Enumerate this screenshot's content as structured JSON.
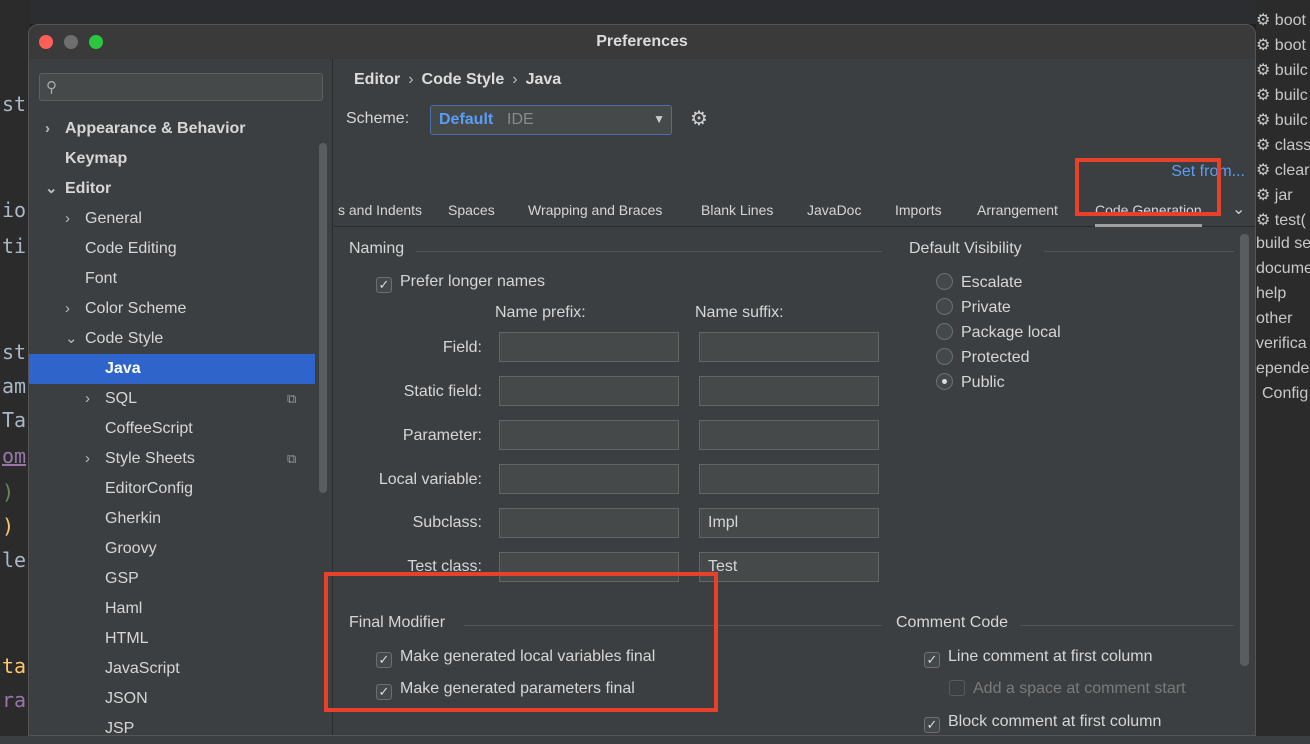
{
  "window": {
    "title": "Preferences"
  },
  "search": {
    "placeholder": ""
  },
  "sidebar": {
    "items": [
      {
        "label": "Appearance & Behavior"
      },
      {
        "label": "Keymap"
      },
      {
        "label": "Editor"
      },
      {
        "label": "General"
      },
      {
        "label": "Code Editing"
      },
      {
        "label": "Font"
      },
      {
        "label": "Color Scheme"
      },
      {
        "label": "Code Style"
      },
      {
        "label": "Java"
      },
      {
        "label": "SQL"
      },
      {
        "label": "CoffeeScript"
      },
      {
        "label": "Style Sheets"
      },
      {
        "label": "EditorConfig"
      },
      {
        "label": "Gherkin"
      },
      {
        "label": "Groovy"
      },
      {
        "label": "GSP"
      },
      {
        "label": "Haml"
      },
      {
        "label": "HTML"
      },
      {
        "label": "JavaScript"
      },
      {
        "label": "JSON"
      },
      {
        "label": "JSP"
      }
    ]
  },
  "breadcrumb": {
    "a": "Editor",
    "b": "Code Style",
    "c": "Java",
    "sep": "›"
  },
  "scheme": {
    "label": "Scheme:",
    "value": "Default",
    "sub": "IDE"
  },
  "set_from": "Set from...",
  "tabs": [
    {
      "label": "s and Indents"
    },
    {
      "label": "Spaces"
    },
    {
      "label": "Wrapping and Braces"
    },
    {
      "label": "Blank Lines"
    },
    {
      "label": "JavaDoc"
    },
    {
      "label": "Imports"
    },
    {
      "label": "Arrangement"
    },
    {
      "label": "Code Generation"
    }
  ],
  "naming": {
    "title": "Naming",
    "prefer_longer": "Prefer longer names",
    "prefix_head": "Name prefix:",
    "suffix_head": "Name suffix:",
    "rows": [
      {
        "label": "Field:",
        "prefix": "",
        "suffix": ""
      },
      {
        "label": "Static field:",
        "prefix": "",
        "suffix": ""
      },
      {
        "label": "Parameter:",
        "prefix": "",
        "suffix": ""
      },
      {
        "label": "Local variable:",
        "prefix": "",
        "suffix": ""
      },
      {
        "label": "Subclass:",
        "prefix": "",
        "suffix": "Impl"
      },
      {
        "label": "Test class:",
        "prefix": "",
        "suffix": "Test"
      }
    ]
  },
  "visibility": {
    "title": "Default Visibility",
    "options": [
      {
        "label": "Escalate"
      },
      {
        "label": "Private"
      },
      {
        "label": "Package local"
      },
      {
        "label": "Protected"
      },
      {
        "label": "Public"
      }
    ],
    "selected": "Public"
  },
  "final_modifier": {
    "title": "Final Modifier",
    "local_vars": "Make generated local variables final",
    "params": "Make generated parameters final"
  },
  "comment_code": {
    "title": "Comment Code",
    "line_first": "Line comment at first column",
    "add_space": "Add a space at comment start",
    "block_first": "Block comment at first column"
  },
  "background": {
    "right_items": [
      "boot",
      "boot",
      "builc",
      "builc",
      "builc",
      "class",
      "clear",
      "jar",
      "test(",
      "build se",
      "docume",
      "help",
      "other",
      "verifica",
      "epender",
      "Config"
    ],
    "left_frags": [
      "st",
      "io",
      "ti",
      "st",
      "am",
      "Ta",
      "om",
      ")",
      ")",
      "le",
      "ta",
      "ra"
    ]
  },
  "check_glyph": "✓",
  "icons": {
    "search": "search-icon",
    "gear": "gear-icon",
    "chevron": "chevron-down-icon"
  }
}
